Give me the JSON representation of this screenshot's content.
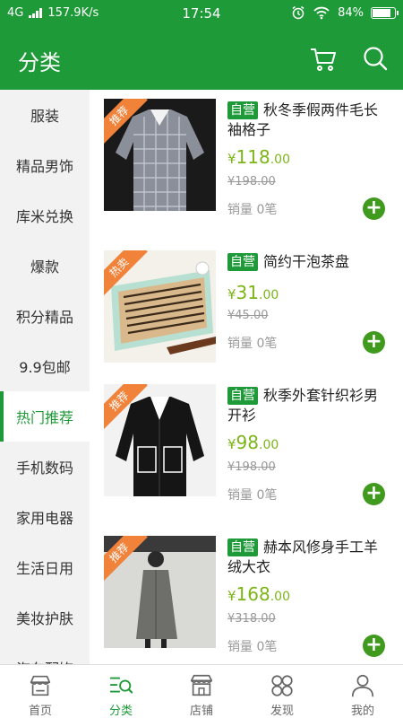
{
  "status_bar": {
    "network": "4G",
    "speed": "157.9K/s",
    "time": "17:54",
    "battery": "84%",
    "battery_level": 0.84
  },
  "app_bar": {
    "title": "分类"
  },
  "sidebar": {
    "items": [
      {
        "label": "服装",
        "active": false
      },
      {
        "label": "精品男饰",
        "active": false
      },
      {
        "label": "库米兑换",
        "active": false
      },
      {
        "label": "爆款",
        "active": false
      },
      {
        "label": "积分精品",
        "active": false
      },
      {
        "label": "9.9包邮",
        "active": false
      },
      {
        "label": "热门推荐",
        "active": true
      },
      {
        "label": "手机数码",
        "active": false
      },
      {
        "label": "家用电器",
        "active": false
      },
      {
        "label": "生活日用",
        "active": false
      },
      {
        "label": "美妆护肤",
        "active": false
      },
      {
        "label": "汽车配饰",
        "active": false
      }
    ]
  },
  "products": [
    {
      "ribbon": "推荐",
      "tag": "自营",
      "name": "秋冬季假两件毛长袖格子",
      "price_currency": "¥",
      "price_int": "118",
      "price_dec": ".00",
      "old_price": "¥198.00",
      "sales": "销量 0笔"
    },
    {
      "ribbon": "热卖",
      "tag": "自营",
      "name": "简约干泡茶盘",
      "price_currency": "¥",
      "price_int": "31",
      "price_dec": ".00",
      "old_price": "¥45.00",
      "sales": "销量 0笔"
    },
    {
      "ribbon": "推荐",
      "tag": "自营",
      "name": "秋季外套针织衫男开衫",
      "price_currency": "¥",
      "price_int": "98",
      "price_dec": ".00",
      "old_price": "¥198.00",
      "sales": "销量 0笔"
    },
    {
      "ribbon": "推荐",
      "tag": "自营",
      "name": "赫本风修身手工羊绒大衣",
      "price_currency": "¥",
      "price_int": "168",
      "price_dec": ".00",
      "old_price": "¥318.00",
      "sales": "销量 0笔"
    }
  ],
  "tab_bar": {
    "tabs": [
      {
        "label": "首页",
        "icon": "home-store-icon",
        "active": false
      },
      {
        "label": "分类",
        "icon": "category-icon",
        "active": true
      },
      {
        "label": "店铺",
        "icon": "shop-icon",
        "active": false
      },
      {
        "label": "发现",
        "icon": "discover-icon",
        "active": false
      },
      {
        "label": "我的",
        "icon": "profile-icon",
        "active": false
      }
    ]
  },
  "colors": {
    "brand": "#1e9a38",
    "price": "#7cb518",
    "ribbon": "#f0823a",
    "add_button": "#3f9a1e"
  }
}
